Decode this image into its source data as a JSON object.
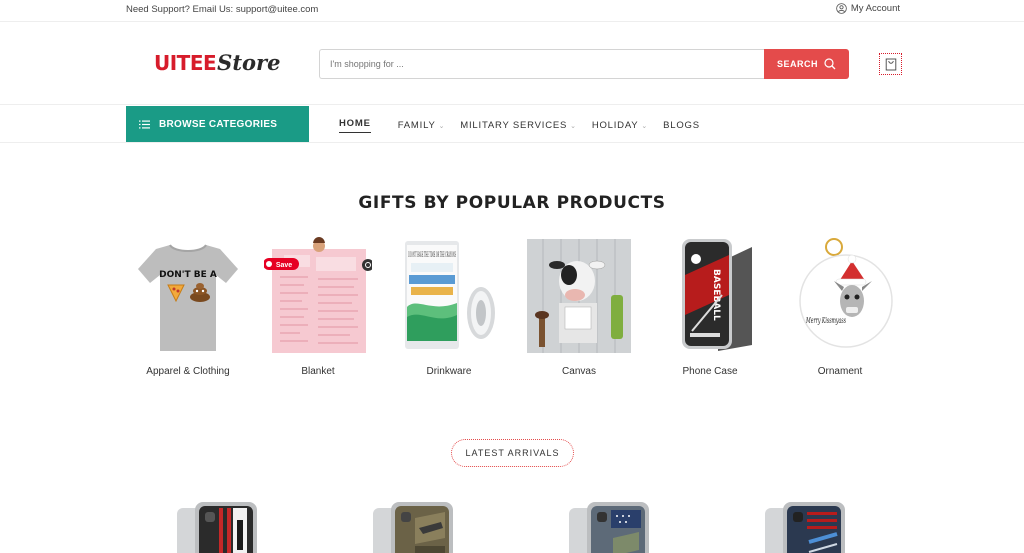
{
  "topbar": {
    "support": "Need Support? Email Us: support@uitee.com",
    "account": "My Account",
    "account_icon": "user-icon"
  },
  "header": {
    "logo_part1": "UITEE",
    "logo_part2": "Store",
    "search_placeholder": "I'm shopping for ...",
    "search_button": "SEARCH",
    "cart_icon": "shopping-bag-icon"
  },
  "nav": {
    "browse": "BROWSE CATEGORIES",
    "items": [
      {
        "label": "HOME",
        "active": true,
        "dropdown": false
      },
      {
        "label": "FAMILY",
        "active": false,
        "dropdown": true
      },
      {
        "label": "MILITARY SERVICES",
        "active": false,
        "dropdown": true
      },
      {
        "label": "HOLIDAY",
        "active": false,
        "dropdown": true
      },
      {
        "label": "BLOGS",
        "active": false,
        "dropdown": false
      }
    ]
  },
  "section": {
    "title": "GIFTS BY POPULAR PRODUCTS",
    "categories": [
      {
        "label": "Apparel & Clothing",
        "shirt_text": "DON'T BE A"
      },
      {
        "label": "Blanket",
        "pin_label": "Save"
      },
      {
        "label": "Drinkware",
        "cup_text": "I DON'T HAVE THE TIME OR THE CRAYONS"
      },
      {
        "label": "Canvas"
      },
      {
        "label": "Phone Case",
        "case_text": "BASEBALL"
      },
      {
        "label": "Ornament",
        "ornament_text": "Merry Kissmyass"
      }
    ]
  },
  "latest": {
    "label": "LATEST ARRIVALS"
  },
  "colors": {
    "accent_red": "#e44b4b",
    "brand_red": "#d71c2b",
    "browse_teal": "#1a9b86"
  }
}
